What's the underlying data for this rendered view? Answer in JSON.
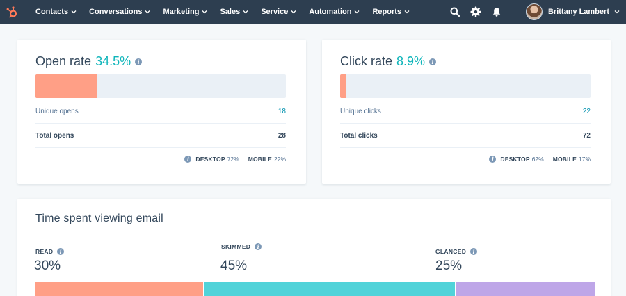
{
  "nav": {
    "items": [
      "Contacts",
      "Conversations",
      "Marketing",
      "Sales",
      "Service",
      "Automation",
      "Reports"
    ],
    "user_name": "Brittany Lambert"
  },
  "open_rate": {
    "title": "Open rate",
    "percent": "34.5%",
    "fill_fraction": 0.245,
    "unique_label": "Unique opens",
    "unique_value": "18",
    "total_label": "Total opens",
    "total_value": "28",
    "desktop_label": "DESKTOP",
    "desktop_value": "72%",
    "mobile_label": "MOBILE",
    "mobile_value": "22%"
  },
  "click_rate": {
    "title": "Click rate",
    "percent": "8.9%",
    "fill_fraction": 0.022,
    "unique_label": "Unique clicks",
    "unique_value": "22",
    "total_label": "Total clicks",
    "total_value": "72",
    "desktop_label": "DESKTOP",
    "desktop_value": "62%",
    "mobile_label": "MOBILE",
    "mobile_value": "17%"
  },
  "time_spent": {
    "title": "Time spent viewing email",
    "segments": [
      {
        "label": "READ",
        "percent": "30%",
        "value": 30,
        "color": "#ff9f86"
      },
      {
        "label": "SKIMMED",
        "percent": "45%",
        "value": 45,
        "color": "#51d3d9"
      },
      {
        "label": "GLANCED",
        "percent": "25%",
        "value": 25,
        "color": "#bea6e8"
      }
    ]
  },
  "colors": {
    "nav_bg": "#2d3e50",
    "accent_teal": "#0fb5ba",
    "link": "#0091ae",
    "bar_track": "#eaf0f6",
    "hubspot_orange": "#ff7a59"
  }
}
